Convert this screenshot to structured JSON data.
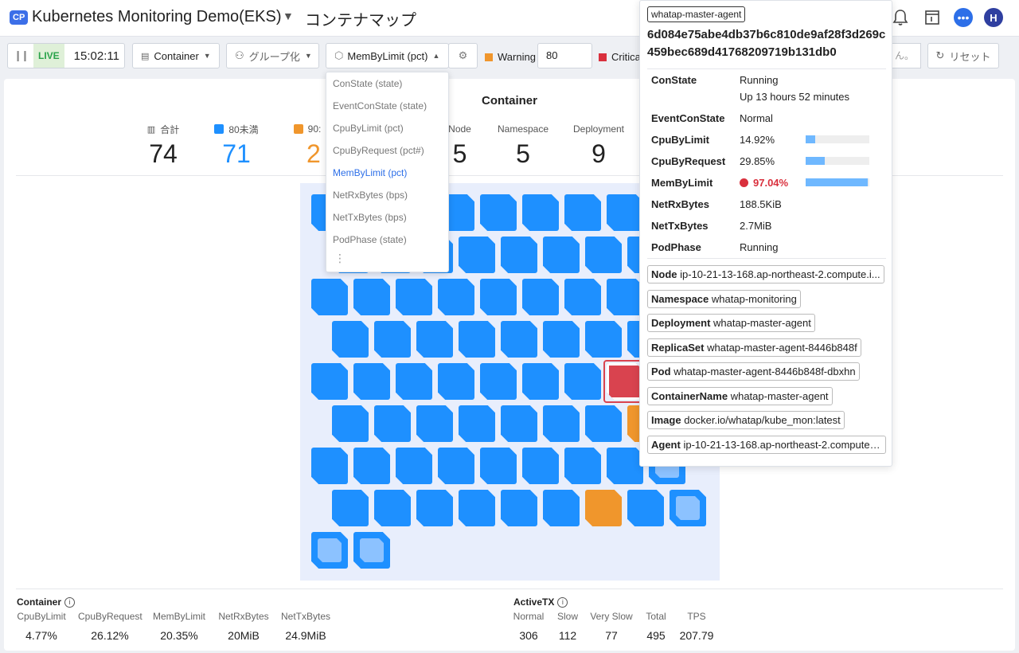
{
  "header": {
    "badge": "CP",
    "project": "Kubernetes Monitoring Demo(EKS)",
    "page_title": "コンテナマップ",
    "avatar": "H"
  },
  "toolbar": {
    "live": "LIVE",
    "time": "15:02:11",
    "container_btn": "Container",
    "group_btn": "グループ化",
    "metric_btn": "MemByLimit (pct)",
    "warning_label": "Warning",
    "warning_value": "80",
    "critical_label": "Critica",
    "search_partial": "ん。",
    "reset": "リセット"
  },
  "colors": {
    "normal": "#1e90ff",
    "warning": "#f0962c",
    "critical": "#d9434f"
  },
  "summary": {
    "title": "Container",
    "total_label": "合計",
    "total": "74",
    "under80_label": "80未満",
    "under80": "71",
    "over90_label": "90:",
    "over90": "2",
    "node_label": "Node",
    "node": "5",
    "namespace_label": "Namespace",
    "namespace": "5",
    "deployment_label": "Deployment",
    "deployment": "9"
  },
  "dropdown": {
    "items": [
      "ConState (state)",
      "EventConState (state)",
      "CpuByLimit (pct)",
      "CpuByRequest (pct#)",
      "MemByLimit (pct)",
      "NetRxBytes (bps)",
      "NetTxBytes (bps)",
      "PodPhase (state)"
    ],
    "selected": "MemByLimit (pct)"
  },
  "tooltip": {
    "name": "whatap-master-agent",
    "id": "6d084e75abe4db37b6c810de9af28f3d269c459bec689d41768209719b131db0",
    "rows": {
      "con_state": {
        "k": "ConState",
        "v": "Running",
        "v2": "Up 13 hours 52 minutes"
      },
      "event_con_state": {
        "k": "EventConState",
        "v": "Normal"
      },
      "cpu_by_limit": {
        "k": "CpuByLimit",
        "v": "14.92%",
        "pct": 14.92
      },
      "cpu_by_request": {
        "k": "CpuByRequest",
        "v": "29.85%",
        "pct": 29.85
      },
      "mem_by_limit": {
        "k": "MemByLimit",
        "v": "97.04%",
        "pct": 97.04
      },
      "net_rx": {
        "k": "NetRxBytes",
        "v": "188.5KiB"
      },
      "net_tx": {
        "k": "NetTxBytes",
        "v": "2.7MiB"
      },
      "pod_phase": {
        "k": "PodPhase",
        "v": "Running"
      }
    },
    "chips": {
      "node": {
        "k": "Node",
        "v": "ip-10-21-13-168.ap-northeast-2.compute.i..."
      },
      "namespace": {
        "k": "Namespace",
        "v": "whatap-monitoring"
      },
      "deployment": {
        "k": "Deployment",
        "v": "whatap-master-agent"
      },
      "replicaset": {
        "k": "ReplicaSet",
        "v": "whatap-master-agent-8446b848f"
      },
      "pod": {
        "k": "Pod",
        "v": "whatap-master-agent-8446b848f-dbxhn"
      },
      "container_name": {
        "k": "ContainerName",
        "v": "whatap-master-agent"
      },
      "image": {
        "k": "Image",
        "v": "docker.io/whatap/kube_mon:latest"
      },
      "agent": {
        "k": "Agent",
        "v": "ip-10-21-13-168.ap-northeast-2.compute.i..."
      }
    }
  },
  "bottom": {
    "container": {
      "title": "Container",
      "cols": [
        {
          "k": "CpuByLimit",
          "v": "4.77%"
        },
        {
          "k": "CpuByRequest",
          "v": "26.12%"
        },
        {
          "k": "MemByLimit",
          "v": "20.35%"
        },
        {
          "k": "NetRxBytes",
          "v": "20MiB"
        },
        {
          "k": "NetTxBytes",
          "v": "24.9MiB"
        }
      ]
    },
    "activetx": {
      "title": "ActiveTX",
      "cols": [
        {
          "k": "Normal",
          "v": "306"
        },
        {
          "k": "Slow",
          "v": "112"
        },
        {
          "k": "Very Slow",
          "v": "77"
        },
        {
          "k": "Total",
          "v": "495"
        },
        {
          "k": "TPS",
          "v": "207.79"
        }
      ]
    }
  }
}
